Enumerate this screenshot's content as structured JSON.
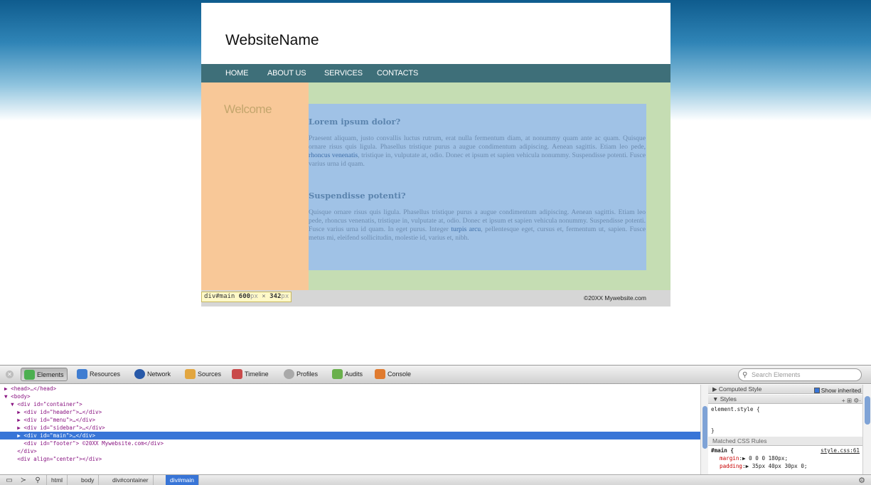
{
  "website": {
    "name": "WebsiteName",
    "menu": [
      "HOME",
      "ABOUT US",
      "SERVICES",
      "CONTACTS"
    ],
    "sidebar_heading": "Welcome",
    "main": {
      "heading1": "Lorem ipsum dolor?",
      "para1_start": "Praesent aliquam, justo convallis luctus rutrum, erat nulla fermentum diam, at nonummy quam ante ac quam. Quisque ornare risus quis ligula. Phasellus tristique purus a augue condimentum adipiscing. Aenean sagittis. Etiam leo pede, ",
      "para1_link": "rhoncus venenatis",
      "para1_end": ", tristique in, vulputate at, odio. Donec et ipsum et sapien vehicula nonummy. Suspendisse potenti. Fusce varius urna id quam.",
      "heading2": "Suspendisse potenti?",
      "para2_start": "Quisque ornare risus quis ligula. Phasellus tristique purus a augue condimentum adipiscing. Aenean sagittis. Etiam leo pede, rhoncus venenatis, tristique in, vulputate at, odio. Donec et ipsum et sapien vehicula nonummy. Suspendisse potenti. Fusce varius urna id quam. In eget purus. Integer ",
      "para2_link": "turpis arcu",
      "para2_end": ", pellentesque eget, cursus et, fermentum ut, sapien. Fusce metus mi, eleifend sollicitudin, molestie id, varius et, nibh."
    },
    "footer": "©20XX Mywebsite.com"
  },
  "inspect_tooltip": {
    "selector": "div#main",
    "width": "600",
    "unit": "px",
    "times": " × ",
    "height": "342"
  },
  "devtools": {
    "tabs": [
      "Elements",
      "Resources",
      "Network",
      "Sources",
      "Timeline",
      "Profiles",
      "Audits",
      "Console"
    ],
    "active_tab": "Elements",
    "search_placeholder": "Search Elements",
    "dom_lines": [
      "▶ <head>…</head>",
      "▼ <body>",
      "  ▼ <div id=\"container\">",
      "    ▶ <div id=\"header\">…</div>",
      "    ▶ <div id=\"menu\">…</div>",
      "    ▶ <div id=\"sidebar\">…</div>",
      "    ▶ <div id=\"main\">…</div>",
      "      <div id=\"footer\"> ©20XX Mywebsite.com</div>",
      "    </div>",
      "    <div align=\"center\"></div>"
    ],
    "selected_line": 6,
    "sidebar": {
      "computed_style": "Computed Style",
      "show_inherited": "Show inherited",
      "styles": "Styles",
      "element_style_open": "element.style {",
      "element_style_close": "}",
      "matched_rules": "Matched CSS Rules",
      "rule_selector": "#main {",
      "rule_source": "style.css:61",
      "rule_prop1": "margin",
      "rule_val1": "▶ 0 0 0 180px;",
      "rule_prop2": "padding",
      "rule_val2": "▶ 35px 40px 30px 0;"
    },
    "breadcrumbs": [
      "html",
      "body",
      "div#container",
      "div#main"
    ],
    "active_crumb": "div#main"
  },
  "colors": {
    "menu_bar": "#3e6f79",
    "sidebar": "#f8c898",
    "main_bg": "#a0c2e6",
    "content_bg": "#c5ddb3",
    "selection": "#3875d7"
  }
}
